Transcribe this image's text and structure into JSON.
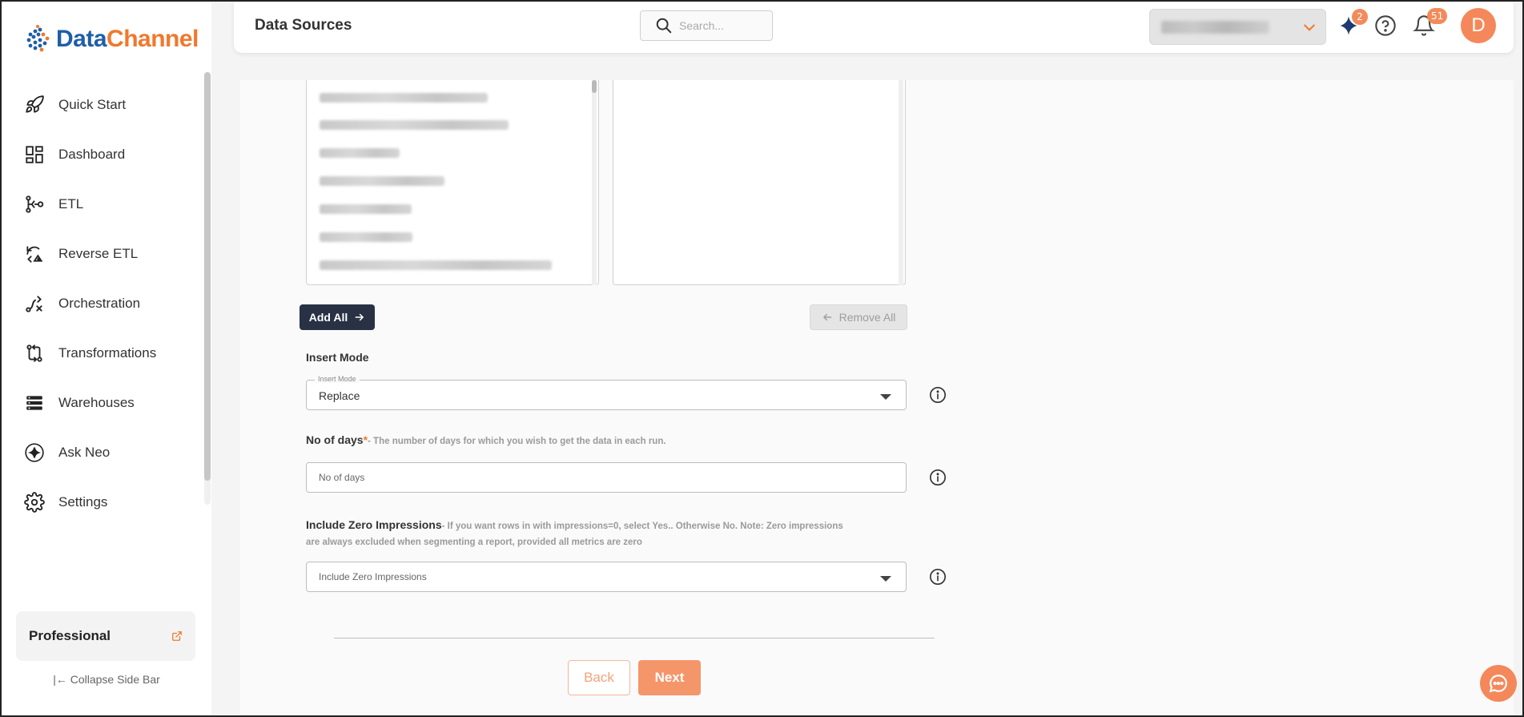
{
  "brand": {
    "part1": "Data",
    "part2": "Channel",
    "blue": "#1f5ea8",
    "orange": "#f0782d"
  },
  "sidebar": {
    "items": [
      {
        "label": "Quick Start",
        "icon": "rocket-icon"
      },
      {
        "label": "Dashboard",
        "icon": "dashboard-icon"
      },
      {
        "label": "ETL",
        "icon": "etl-icon"
      },
      {
        "label": "Reverse ETL",
        "icon": "reverse-etl-icon"
      },
      {
        "label": "Orchestration",
        "icon": "orchestration-icon"
      },
      {
        "label": "Transformations",
        "icon": "transformations-icon"
      },
      {
        "label": "Warehouses",
        "icon": "warehouses-icon"
      },
      {
        "label": "Ask Neo",
        "icon": "sparkle-icon"
      },
      {
        "label": "Settings",
        "icon": "gear-icon"
      }
    ],
    "plan": "Professional",
    "collapse_label": "Collapse Side Bar"
  },
  "header": {
    "title": "Data Sources",
    "search_placeholder": "Search...",
    "ai_badge": "2",
    "notifications_badge": "51",
    "avatar_initial": "D",
    "accent": "#f5885a"
  },
  "form": {
    "add_all_label": "Add All",
    "remove_all_label": "Remove All",
    "insert_mode": {
      "section_label": "Insert Mode",
      "floating_label": "Insert Mode",
      "value": "Replace"
    },
    "no_of_days": {
      "label": "No of days",
      "required_mark": "*",
      "hint": "- The number of days for which you wish to get the data in each run.",
      "placeholder": "No of days"
    },
    "zero_impressions": {
      "label": "Include Zero Impressions",
      "hint_line1": "- If you want rows in with impressions=0, select Yes.. Otherwise No. Note: Zero impressions",
      "hint_line2": "are always excluded when segmenting a report, provided all metrics are zero",
      "placeholder": "Include Zero Impressions"
    },
    "back_label": "Back",
    "next_label": "Next"
  }
}
